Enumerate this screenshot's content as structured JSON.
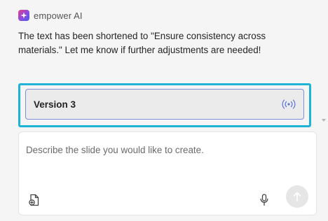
{
  "assistant": {
    "name": "empower AI",
    "logo_icon": "empower-logo-icon"
  },
  "message": {
    "text": "The text has been shortened to \"Ensure consistency across materials.\" Let me know if further adjustments are needed!"
  },
  "version_card": {
    "label": "Version 3",
    "icon": "broadcast-icon",
    "highlight_color": "#1fb3d8",
    "border_color": "#7a8fd6",
    "icon_color": "#5a73d6"
  },
  "input": {
    "placeholder": "Describe the slide you would like to create.",
    "attach_icon": "add-file-icon",
    "mic_icon": "microphone-icon",
    "send_icon": "send-arrow-icon"
  }
}
